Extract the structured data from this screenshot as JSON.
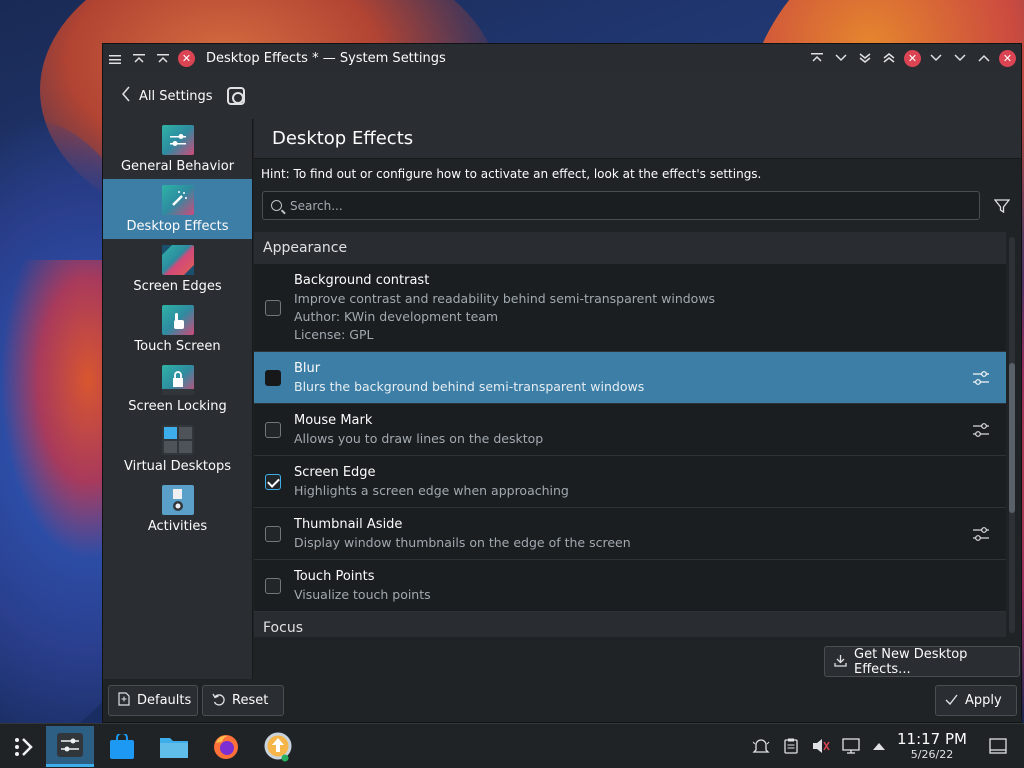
{
  "window": {
    "title": "Desktop Effects * — System Settings"
  },
  "toolbar": {
    "back_label": "All Settings"
  },
  "sidebar": {
    "items": [
      {
        "label": "General Behavior",
        "icon": "general-behavior-icon"
      },
      {
        "label": "Desktop Effects",
        "icon": "desktop-effects-icon"
      },
      {
        "label": "Screen Edges",
        "icon": "screen-edges-icon"
      },
      {
        "label": "Touch Screen",
        "icon": "touch-screen-icon"
      },
      {
        "label": "Screen Locking",
        "icon": "screen-locking-icon"
      },
      {
        "label": "Virtual Desktops",
        "icon": "virtual-desktops-icon"
      },
      {
        "label": "Activities",
        "icon": "activities-icon"
      }
    ]
  },
  "main": {
    "page_title": "Desktop Effects",
    "hint": "Hint: To find out or configure how to activate an effect, look at the effect's settings.",
    "search_placeholder": "Search...",
    "sections": {
      "appearance": "Appearance",
      "focus": "Focus"
    },
    "effects": [
      {
        "name": "Background contrast",
        "desc": "Improve contrast and readability behind semi-transparent windows",
        "author": "Author: KWin development team",
        "license": "License: GPL",
        "checked": false,
        "configurable": false
      },
      {
        "name": "Blur",
        "desc": "Blurs the background behind semi-transparent windows",
        "checked": false,
        "configurable": true,
        "selected": true
      },
      {
        "name": "Mouse Mark",
        "desc": "Allows you to draw lines on the desktop",
        "checked": false,
        "configurable": true
      },
      {
        "name": "Screen Edge",
        "desc": "Highlights a screen edge when approaching",
        "checked": true,
        "configurable": false
      },
      {
        "name": "Thumbnail Aside",
        "desc": "Display window thumbnails on the edge of the screen",
        "checked": false,
        "configurable": true
      },
      {
        "name": "Touch Points",
        "desc": "Visualize touch points",
        "checked": false,
        "configurable": false
      }
    ],
    "get_new_label": "Get New Desktop Effects..."
  },
  "footer": {
    "defaults_label": "Defaults",
    "reset_label": "Reset",
    "apply_label": "Apply"
  },
  "taskbar": {
    "time": "11:17 PM",
    "date": "5/26/22"
  },
  "colors": {
    "accent": "#3daee9",
    "selection": "#3d7ea6",
    "close": "#da4453",
    "window_bg": "#202326"
  }
}
